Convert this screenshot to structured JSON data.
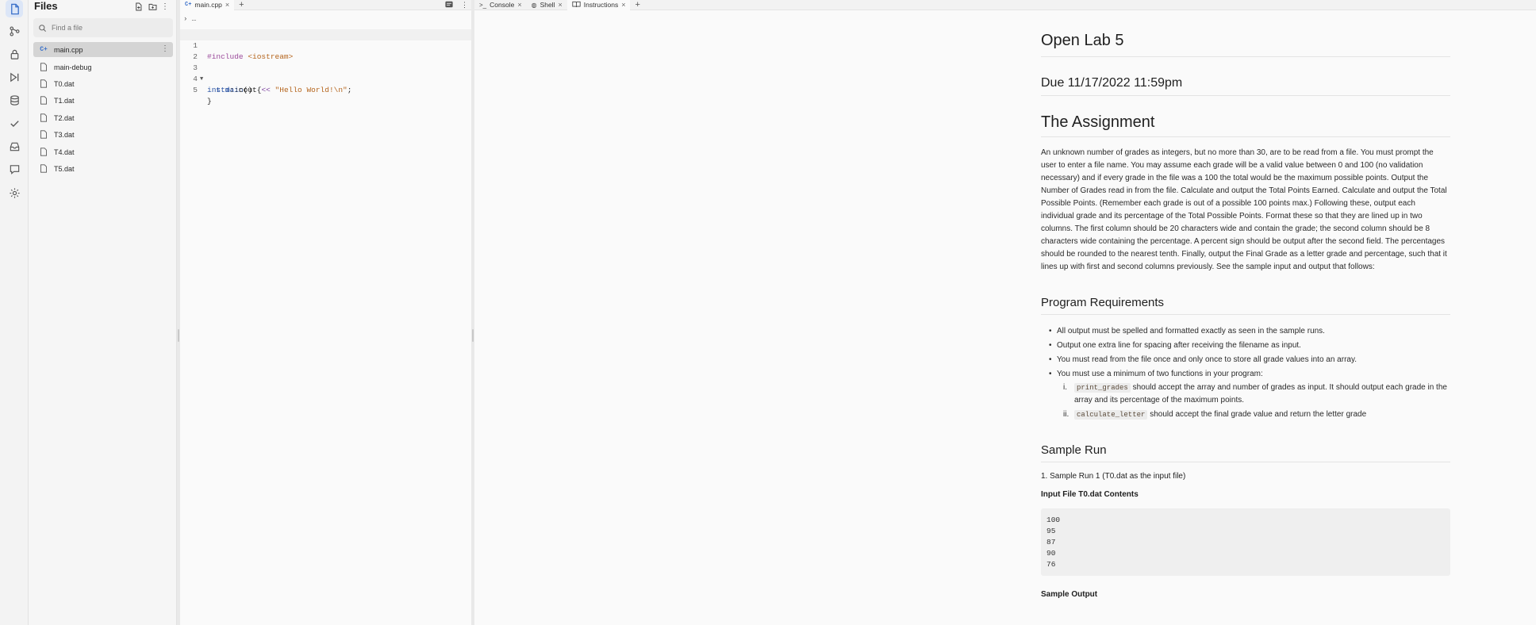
{
  "files_panel": {
    "title": "Files",
    "search_placeholder": "Find a file",
    "items": [
      {
        "name": "main.cpp",
        "type": "cpp",
        "selected": true
      },
      {
        "name": "main-debug",
        "type": "file"
      },
      {
        "name": "T0.dat",
        "type": "file"
      },
      {
        "name": "T1.dat",
        "type": "file"
      },
      {
        "name": "T2.dat",
        "type": "file"
      },
      {
        "name": "T3.dat",
        "type": "file"
      },
      {
        "name": "T4.dat",
        "type": "file"
      },
      {
        "name": "T5.dat",
        "type": "file"
      }
    ],
    "more_glyph": "⋮"
  },
  "editor": {
    "tab_label": "main.cpp",
    "breadcrumb": "› …",
    "code_lines": [
      {
        "n": "1",
        "text": "#include <iostream>"
      },
      {
        "n": "2",
        "text": ""
      },
      {
        "n": "3",
        "text": "int main() {"
      },
      {
        "n": "4",
        "text": "  std::cout << \"Hello World!\\n\";"
      },
      {
        "n": "5",
        "text": "}"
      }
    ]
  },
  "right_tabs": [
    {
      "label": "Console",
      "icon": ">_"
    },
    {
      "label": "Shell",
      "icon": "◍"
    },
    {
      "label": "Instructions",
      "icon": "📖"
    }
  ],
  "instructions": {
    "title": "Open Lab 5",
    "due": "Due 11/17/2022 11:59pm",
    "heading_assignment": "The Assignment",
    "assignment_text": "An unknown number of grades as integers, but no more than 30, are to be read from a file. You must prompt the user to enter a file name. You may assume each grade will be a valid value between 0 and 100 (no validation necessary) and if every grade in the file was a 100 the total would be the maximum possible points. Output the Number of Grades read in from the file. Calculate and output the Total Points Earned. Calculate and output the Total Possible Points. (Remember each grade is out of a possible 100 points max.) Following these, output each individual grade and its percentage of the Total Possible Points. Format these so that they are lined up in two columns. The first column should be 20 characters wide and contain the grade; the second column should be 8 characters wide containing the percentage. A percent sign should be output after the second field. The percentages should be rounded to the nearest tenth. Finally, output the Final Grade as a letter grade and percentage, such that it lines up with first and second columns previously. See the sample input and output that follows:",
    "heading_requirements": "Program Requirements",
    "requirements": [
      "All output must be spelled and formatted exactly as seen in the sample runs.",
      "Output one extra line for spacing after receiving the filename as input.",
      "You must read from the file once and only once to store all grade values into an array.",
      "You must use a minimum of two functions in your program:"
    ],
    "sub_requirements": [
      {
        "roman": "i.",
        "code": "print_grades",
        "text": " should accept the array and number of grades as input. It should output each grade in the array and its percentage of the maximum points."
      },
      {
        "roman": "ii.",
        "code": "calculate_letter",
        "text": " should accept the final grade value and return the letter grade"
      }
    ],
    "heading_sample": "Sample Run",
    "sample_run_item": "1. Sample Run 1 (T0.dat as the input file)",
    "input_label": "Input File T0.dat Contents",
    "input_contents": "100\n95\n87\n90\n76",
    "output_label": "Sample Output"
  }
}
